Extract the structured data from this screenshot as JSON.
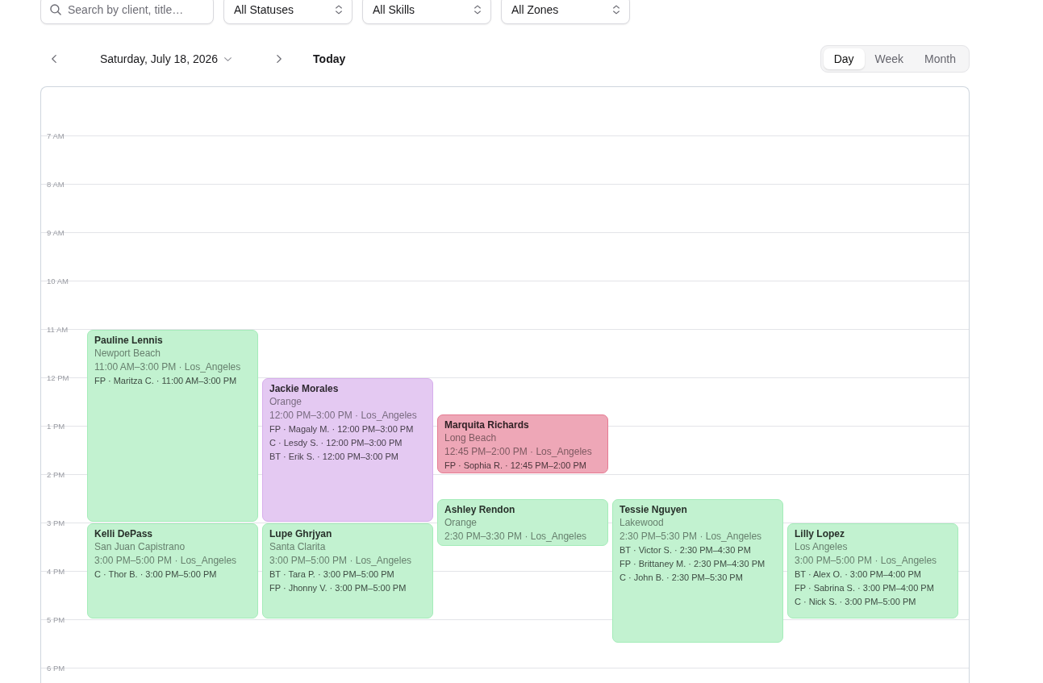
{
  "filters": {
    "search": {
      "placeholder": "Search by client, title…"
    },
    "selects": [
      {
        "value": "All Statuses"
      },
      {
        "value": "All Skills"
      },
      {
        "value": "All Zones"
      }
    ]
  },
  "navigation": {
    "date": "Saturday, July 18, 2026",
    "today": "Today"
  },
  "views": [
    {
      "label": "Day",
      "selected": true
    },
    {
      "label": "Week",
      "selected": false
    },
    {
      "label": "Month",
      "selected": false
    }
  ],
  "calendar": {
    "hours": [
      "7 AM",
      "8 AM",
      "9 AM",
      "10 AM",
      "11 AM",
      "12 PM",
      "1 PM",
      "2 PM",
      "3 PM",
      "4 PM",
      "5 PM",
      "6 PM"
    ],
    "events": [
      {
        "client": "Pauline Lennis",
        "location": "Newport Beach",
        "time": "11:00 AM–3:00 PM · Los_Angeles",
        "color": "#c2f2d0",
        "assignments": [
          "FP · Maritza C. · 11:00 AM–3:00 PM"
        ]
      },
      {
        "client": "Jackie Morales",
        "location": "Orange",
        "time": "12:00 PM–3:00 PM · Los_Angeles",
        "color": "#e4c9f2",
        "assignments": [
          "FP · Magaly M. · 12:00 PM–3:00 PM",
          "C · Lesdy S. · 12:00 PM–3:00 PM",
          "BT · Erik S. · 12:00 PM–3:00 PM"
        ]
      },
      {
        "client": "Marquita Richards",
        "location": "Long Beach",
        "time": "12:45 PM–2:00 PM · Los_Angeles",
        "color": "#eea7b7",
        "assignments": [
          "FP · Sophia R. · 12:45 PM–2:00 PM"
        ]
      },
      {
        "client": "Kelli DePass",
        "location": "San Juan Capistrano",
        "time": "3:00 PM–5:00 PM · Los_Angeles",
        "color": "#c2f2d0",
        "assignments": [
          "C · Thor B. · 3:00 PM–5:00 PM"
        ]
      },
      {
        "client": "Lupe Ghrjyan",
        "location": "Santa Clarita",
        "time": "3:00 PM–5:00 PM · Los_Angeles",
        "color": "#c2f2d0",
        "assignments": [
          "BT · Tara P. · 3:00 PM–5:00 PM",
          "FP · Jhonny V. · 3:00 PM–5:00 PM"
        ]
      },
      {
        "client": "Ashley Rendon",
        "location": "Orange",
        "time": "2:30 PM–3:30 PM · Los_Angeles",
        "color": "#c2f2d0"
      },
      {
        "client": "Tessie Nguyen",
        "location": "Lakewood",
        "time": "2:30 PM–5:30 PM · Los_Angeles",
        "color": "#c2f2d0",
        "assignments": [
          "BT · Victor S. · 2:30 PM–4:30 PM",
          "FP · Brittaney M. · 2:30 PM–4:30 PM",
          "C · John B. · 2:30 PM–5:30 PM"
        ]
      },
      {
        "client": "Lilly Lopez",
        "location": "Los Angeles",
        "time": "3:00 PM–5:00 PM · Los_Angeles",
        "color": "#c2f2d0",
        "assignments": [
          "BT · Alex O. · 3:00 PM–4:00 PM",
          "FP · Sabrina S. · 3:00 PM–4:00 PM",
          "C · Nick S. · 3:00 PM–5:00 PM"
        ]
      }
    ]
  }
}
